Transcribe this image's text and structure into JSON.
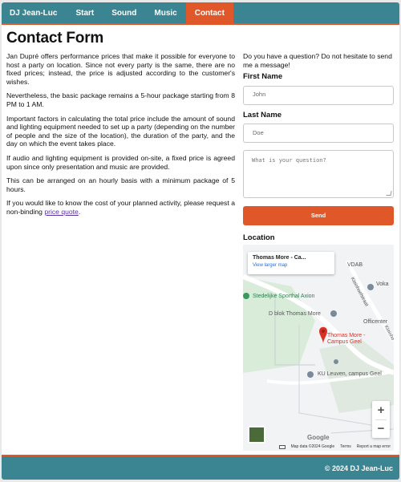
{
  "nav": {
    "brand": "DJ Jean-Luc",
    "items": [
      {
        "label": "Start",
        "active": false
      },
      {
        "label": "Sound",
        "active": false
      },
      {
        "label": "Music",
        "active": false
      },
      {
        "label": "Contact",
        "active": true
      }
    ]
  },
  "page_title": "Contact Form",
  "intro": {
    "paragraphs": [
      "Jan Dupré offers performance prices that make it possible for everyone to host a party on location. Since not every party is the same, there are no fixed prices; instead, the price is adjusted according to the customer's wishes.",
      "Nevertheless, the basic package remains a 5-hour package starting from 8 PM to 1 AM.",
      "Important factors in calculating the total price include the amount of sound and lighting equipment needed to set up a party (depending on the number of people and the size of the location), the duration of the party, and the day on which the event takes place.",
      "If audio and lighting equipment is provided on-site, a fixed price is agreed upon since only presentation and music are provided.",
      "This can be arranged on an hourly basis with a minimum package of 5 hours."
    ],
    "last_paragraph_prefix": "If you would like to know the cost of your planned activity, please request a non-binding ",
    "quote_link": "price quote",
    "last_paragraph_suffix": "."
  },
  "form": {
    "question_prompt": "Do you have a question? Do not hesitate to send me a message!",
    "first_name_label": "First Name",
    "first_name_placeholder": "John",
    "last_name_label": "Last Name",
    "last_name_placeholder": "Doe",
    "message_placeholder": "What is your question?",
    "send_label": "Send"
  },
  "location": {
    "label": "Location",
    "map": {
      "card_title": "Thomas More - Ca...",
      "card_link": "View larger map",
      "labels": {
        "vdab": "VDAB",
        "voka": "Voka",
        "sporthal": "Stedelijke Sporthal Axion",
        "dblok": "D blok Thomas More",
        "officenter": "Officenter",
        "campus_line1": "Thomas More -",
        "campus_line2": "Campus Geel",
        "kuleuven": "KU Leuven, campus Geel",
        "street1": "Kleinhoefstraat",
        "street2": "Kleinho"
      },
      "zoom_in": "+",
      "zoom_out": "−",
      "google": "Google",
      "attribution": [
        "Map data ©2024 Google",
        "Terms",
        "Report a map error"
      ]
    }
  },
  "footer": "© 2024 DJ Jean-Luc",
  "colors": {
    "accent": "#e0582a",
    "nav_bg": "#3a8591",
    "link": "#5c2fa5"
  }
}
